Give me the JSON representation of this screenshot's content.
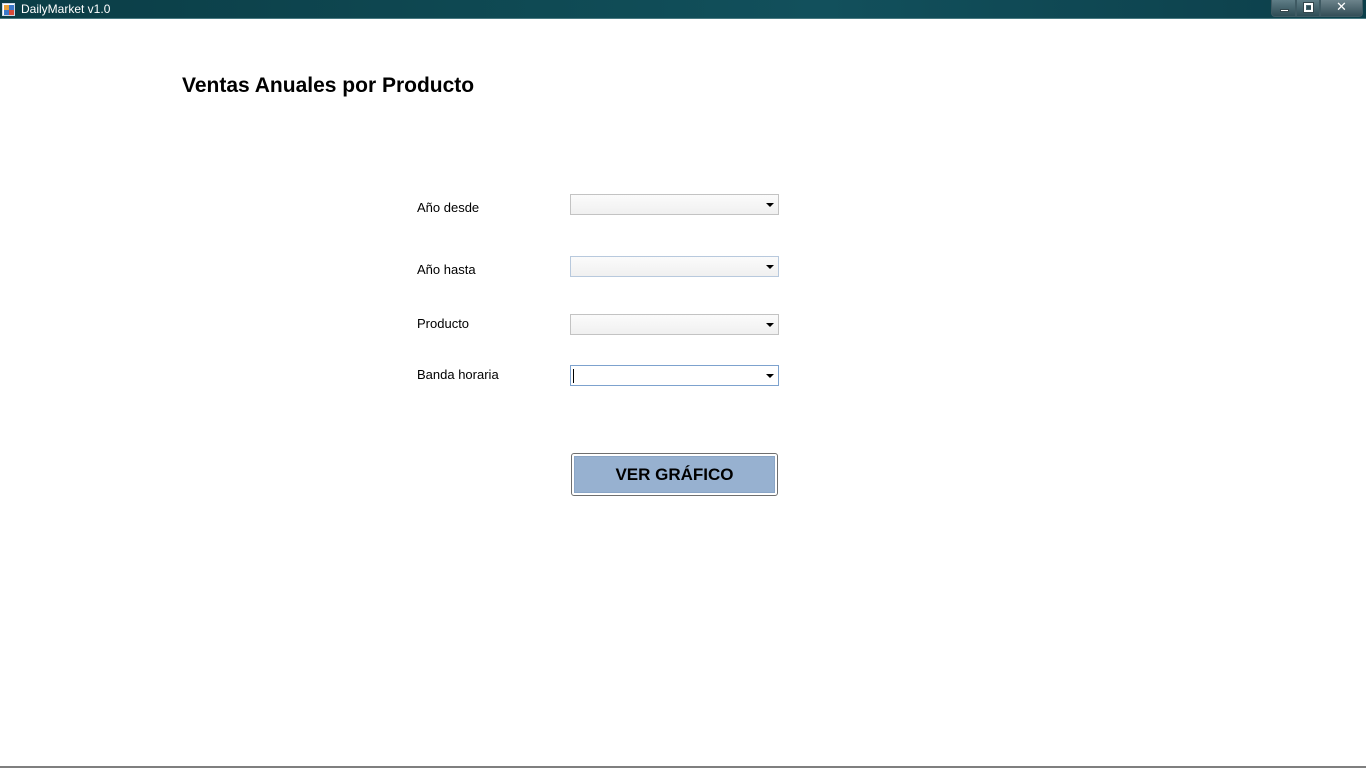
{
  "window": {
    "title": "DailyMarket v1.0",
    "controls": {
      "minimize": "minimize",
      "maximize": "maximize",
      "close": "✕"
    }
  },
  "page": {
    "title": "Ventas Anuales por Producto"
  },
  "form": {
    "fields": [
      {
        "label": "Año desde",
        "value": ""
      },
      {
        "label": "Año hasta",
        "value": ""
      },
      {
        "label": "Producto",
        "value": ""
      },
      {
        "label": "Banda horaria",
        "value": "",
        "focused": true
      }
    ],
    "submit_label": "VER GRÁFICO"
  },
  "colors": {
    "titlebar": "#0f4a54",
    "button_fill": "#97b1d0",
    "focus_border": "#7da2ce"
  }
}
